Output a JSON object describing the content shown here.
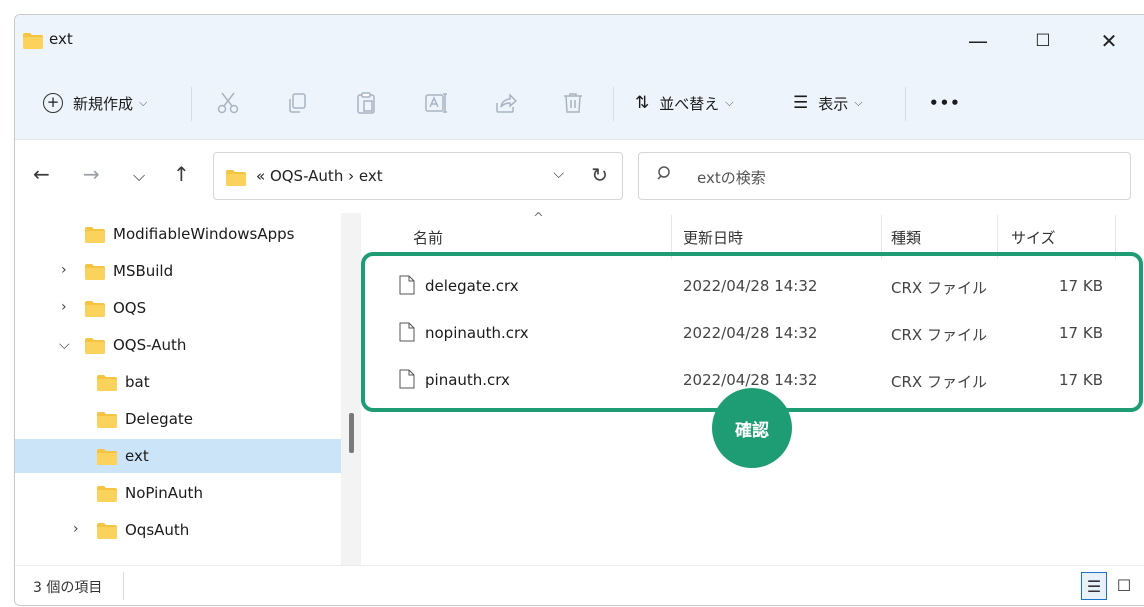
{
  "window": {
    "title": "ext"
  },
  "title_controls": {
    "minimize": "—",
    "maximize": "☐",
    "close": "✕"
  },
  "toolbar": {
    "new_label": "新規作成",
    "sort_label": "並べ替え",
    "view_label": "表示",
    "more_label": "•••"
  },
  "nav": {
    "back": "←",
    "forward": "→",
    "recent": "⌵",
    "up": "↑"
  },
  "address": {
    "crumbs": "«  OQS-Auth  ›  ext",
    "dropdown": "⌵",
    "refresh": "↻"
  },
  "search": {
    "placeholder": "extの検索",
    "icon": "magnifier-icon"
  },
  "sidebar": {
    "items": [
      {
        "label": "ModifiableWindowsApps",
        "arrow": ""
      },
      {
        "label": "MSBuild",
        "arrow": "›"
      },
      {
        "label": "OQS",
        "arrow": "›"
      },
      {
        "label": "OQS-Auth",
        "arrow": "⌵"
      },
      {
        "label": "bat",
        "arrow": ""
      },
      {
        "label": "Delegate",
        "arrow": ""
      },
      {
        "label": "ext",
        "arrow": ""
      },
      {
        "label": "NoPinAuth",
        "arrow": ""
      },
      {
        "label": "OqsAuth",
        "arrow": "›"
      }
    ]
  },
  "columns": {
    "name": "名前",
    "date": "更新日時",
    "type": "種類",
    "size": "サイズ"
  },
  "files": [
    {
      "name": "delegate.crx",
      "date": "2022/04/28 14:32",
      "type": "CRX ファイル",
      "size": "17 KB"
    },
    {
      "name": "nopinauth.crx",
      "date": "2022/04/28 14:32",
      "type": "CRX ファイル",
      "size": "17 KB"
    },
    {
      "name": "pinauth.crx",
      "date": "2022/04/28 14:32",
      "type": "CRX ファイル",
      "size": "17 KB"
    }
  ],
  "annotation": {
    "badge": "確認",
    "color": "#1e9c74"
  },
  "status": {
    "item_count": "3 個の項目"
  },
  "colors": {
    "accent": "#1e9c74",
    "selection": "#cce4f7",
    "folder": "#f6c443",
    "chrome": "#eef4fb"
  }
}
